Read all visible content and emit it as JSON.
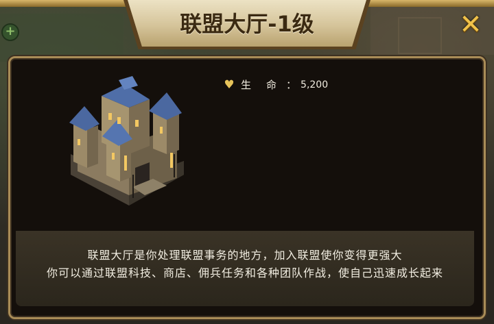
{
  "dialog": {
    "title": "联盟大厅-1级",
    "close_glyph": "✕"
  },
  "stats": [
    {
      "icon": "heart-icon",
      "label": "生命",
      "separator": "：",
      "value": "5,200"
    }
  ],
  "description": {
    "line1": "联盟大厅是你处理联盟事务的地方，加入联盟使你变得更强大",
    "line2": "你可以通过联盟科技、商店、佣兵任务和各种团队作战，使自己迅速成长起来"
  },
  "colors": {
    "panel_border": "#a98c57",
    "panel_bg": "#140f0b",
    "title_text": "#3b2a12",
    "close_icon": "#f0c24a",
    "heart_icon": "#e7c35a"
  }
}
